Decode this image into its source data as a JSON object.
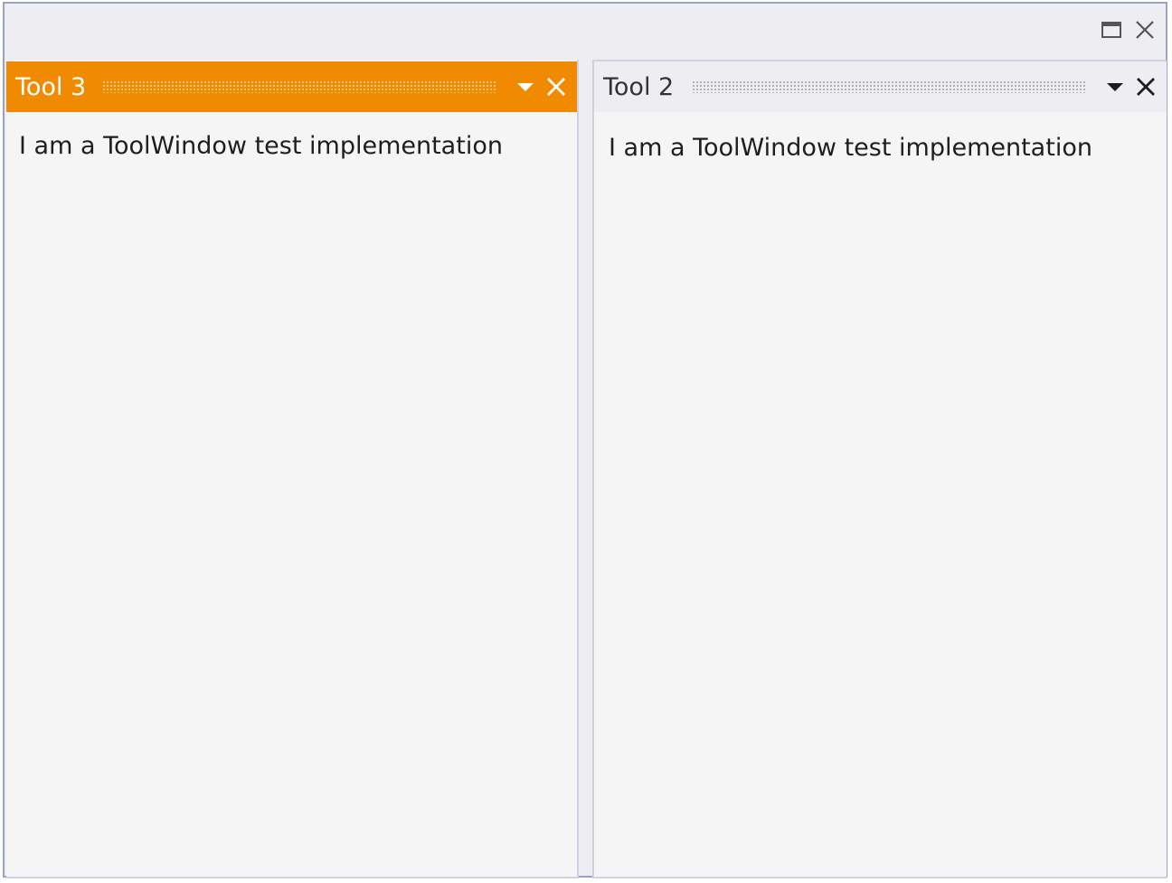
{
  "window": {
    "maximize_icon": "maximize-icon",
    "close_icon": "close-icon"
  },
  "panes": [
    {
      "title": "Tool 3",
      "active": true,
      "accent": "#f08a00",
      "content": "I am a ToolWindow test implementation"
    },
    {
      "title": "Tool 2",
      "active": false,
      "content": "I am a ToolWindow test implementation"
    }
  ],
  "colors": {
    "window_border": "#9aa3c7",
    "window_bg": "#eeeef2",
    "pane_bg": "#f5f5f5",
    "active_header": "#f08a00"
  }
}
